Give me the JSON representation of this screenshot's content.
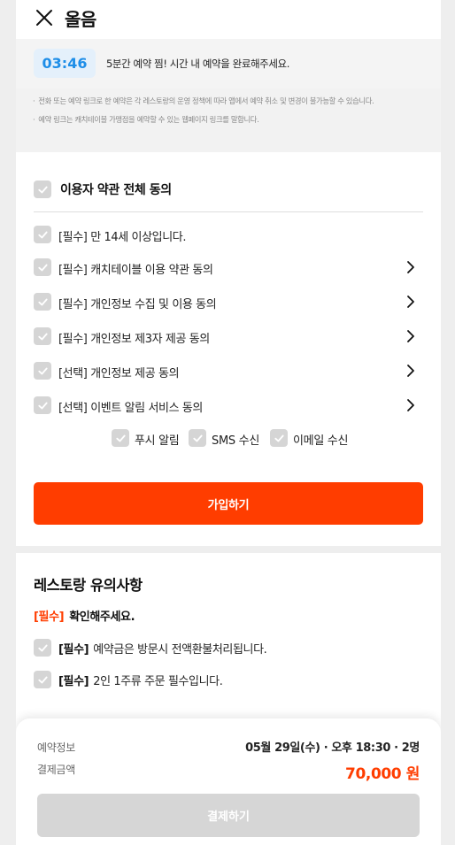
{
  "header": {
    "title": "올음"
  },
  "timer": {
    "time": "03:46",
    "message": "5분간 예약 찜! 시간 내 예약을 완료해주세요."
  },
  "notices": [
    "전화 또는 예약 링크로 한 예약은 각 레스토랑의 운영 정책에 따라 앱에서 예약 취소 및 변경이 불가능할 수 있습니다.",
    "예약 링크는 캐치테이블 가맹점을 예약할 수 있는 웹페이지 링크를 말합니다."
  ],
  "terms": {
    "all_label": "이용자 약관 전체 동의",
    "items": [
      {
        "label": "[필수] 만 14세 이상입니다."
      },
      {
        "label": "[필수] 캐치테이블 이용 약관 동의"
      },
      {
        "label": "[필수] 개인정보 수집 및 이용 동의"
      },
      {
        "label": "[필수] 개인정보 제3자 제공 동의"
      },
      {
        "label": "[선택] 개인정보 제공 동의"
      },
      {
        "label": "[선택] 이벤트 알림 서비스 동의"
      }
    ],
    "channels": [
      "푸시 알림",
      "SMS 수신",
      "이메일 수신"
    ]
  },
  "join_button": "가입하기",
  "restaurant_notice": {
    "title": "레스토랑 유의사항",
    "required_tag": "[필수]",
    "required_text": "확인해주세요.",
    "rules": [
      {
        "tag": "[필수]",
        "text": "예약금은 방문시 전액환불처리됩니다."
      },
      {
        "tag": "[필수]",
        "text": "2인 1주류 주문 필수입니다."
      }
    ]
  },
  "booking": {
    "info_label": "예약정보",
    "info_value": "05월 29일(수) · 오후 18:30 · 2명",
    "amount_label": "결제금액",
    "amount_value": "70,000 원",
    "pay_button": "결제하기"
  },
  "colors": {
    "accent": "#ff3d00",
    "timer": "#1e8ee8",
    "checkbox": "#d5d5d5",
    "disabled": "#d6d6d6"
  },
  "icons": {
    "close": "close-icon",
    "check": "check-icon",
    "chevron": "chevron-right-icon"
  }
}
